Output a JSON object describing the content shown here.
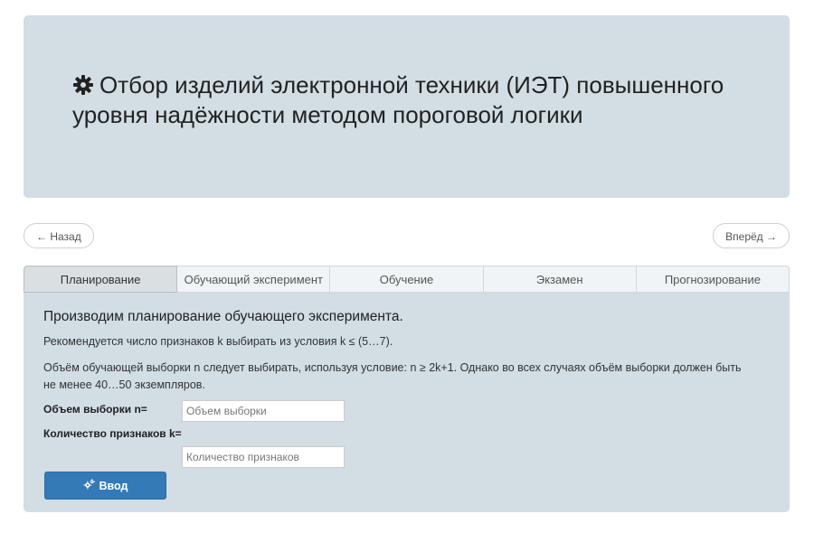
{
  "header": {
    "title": "Отбор изделий электронной техники (ИЭТ) повышенного уровня надёжности методом пороговой логики",
    "icon": "gear-icon"
  },
  "pager": {
    "back_label": "← Назад",
    "forward_label": "Вперёд →"
  },
  "tabs": [
    {
      "label": "Планирование",
      "active": true
    },
    {
      "label": "Обучающий эксперимент",
      "active": false
    },
    {
      "label": "Обучение",
      "active": false
    },
    {
      "label": "Экзамен",
      "active": false
    },
    {
      "label": "Прогнозирование",
      "active": false
    }
  ],
  "panel": {
    "heading": "Производим планирование обучающего эксперимента.",
    "paragraph1": "Рекомендуется число признаков k выбирать из условия k ≤ (5…7).",
    "paragraph2": "Объём обучающей выборки n следует выбирать, используя условие: n ≥ 2k+1. Однако во всех случаях объём выборки должен быть не менее 40…50 экземпляров.",
    "sample_size": {
      "label": "Объем выборки n=",
      "placeholder": "Объем выборки",
      "value": ""
    },
    "feature_count": {
      "label": "Количество признаков k=",
      "placeholder": "Количество признаков",
      "value": ""
    },
    "submit": {
      "label": "Ввод",
      "icon": "gears-icon"
    }
  },
  "colors": {
    "jumbotron_bg": "#d2dde4",
    "primary": "#337ab7",
    "active_tab_bg": "#dadfe2"
  }
}
